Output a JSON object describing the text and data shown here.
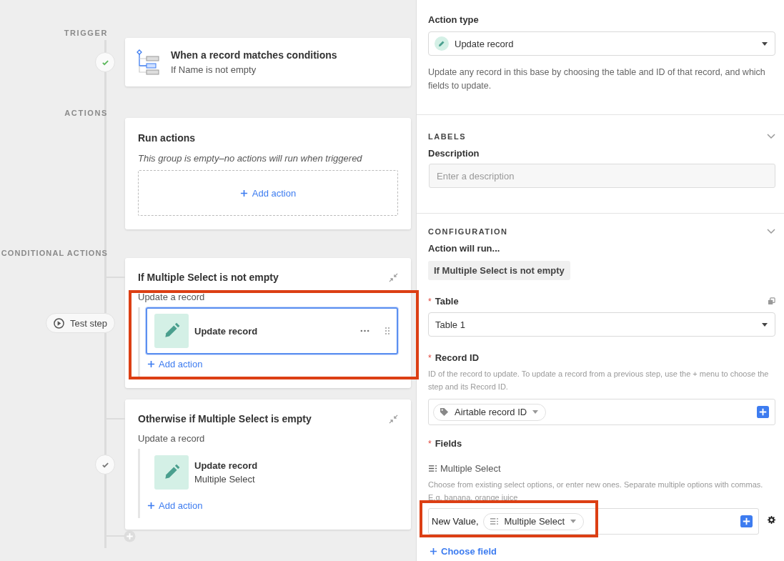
{
  "flow": {
    "trigger": {
      "section_label": "TRIGGER",
      "passed": true,
      "title": "When a record matches conditions",
      "subtitle": "If Name is not empty"
    },
    "actions": {
      "section_label": "ACTIONS",
      "title": "Run actions",
      "empty_note": "This group is empty–no actions will run when triggered",
      "add_label": "Add action"
    },
    "conditional": {
      "section_label": "CONDITIONAL ACTIONS",
      "branches": [
        {
          "title": "If Multiple Select is not empty",
          "node": {
            "kind": "test-button",
            "label": "Test step"
          },
          "group_label": "Update a record",
          "add_label": "Add action",
          "steps": [
            {
              "title": "Update record",
              "selected": true
            }
          ]
        },
        {
          "title": "Otherwise if Multiple Select is empty",
          "node": {
            "kind": "check",
            "passed": false
          },
          "group_label": "Update a record",
          "add_label": "Add action",
          "steps": [
            {
              "title": "Update record",
              "subtitle": "Multiple Select",
              "selected": false
            }
          ]
        }
      ]
    }
  },
  "details": {
    "action_type": {
      "label": "Action type",
      "value": "Update record",
      "description": "Update any record in this base by choosing the table and ID of that record, and which fields to update."
    },
    "labels": {
      "heading": "LABELS",
      "field_label": "Description",
      "placeholder": "Enter a description"
    },
    "configuration": {
      "heading": "CONFIGURATION",
      "run_label": "Action will run...",
      "condition": "If Multiple Select is not empty",
      "table": {
        "required_mark": "*",
        "label": "Table",
        "value": "Table 1"
      },
      "record_id": {
        "required_mark": "*",
        "label": "Record ID",
        "help": "ID of the record to update. To update a record from a previous step, use the + menu to choose the step and its Record ID.",
        "token": "Airtable record ID"
      },
      "fields": {
        "required_mark": "*",
        "label": "Fields",
        "items": [
          {
            "name": "Multiple Select",
            "help": "Choose from existing select options, or enter new ones. Separate multiple options with commas. E.g. banana, orange juice",
            "value_text": "New Value,",
            "token": "Multiple Select"
          }
        ]
      },
      "choose_field": "Choose field"
    }
  }
}
